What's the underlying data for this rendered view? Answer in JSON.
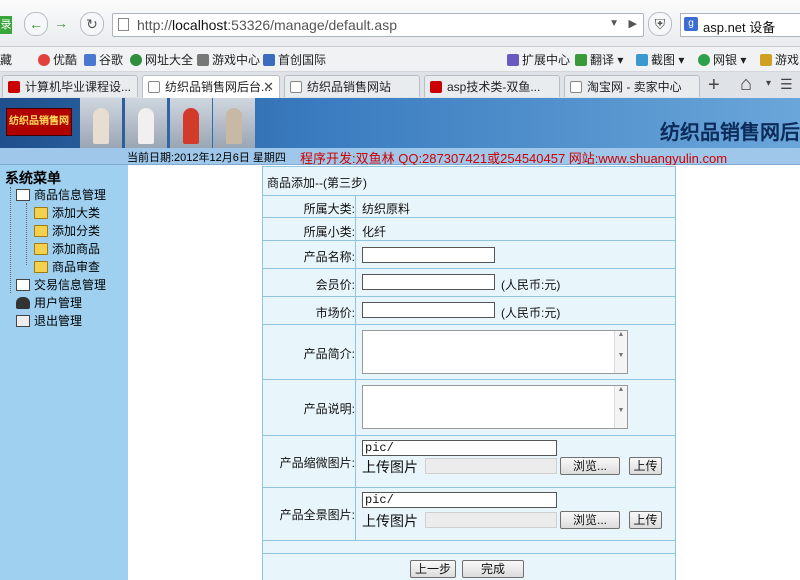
{
  "browser": {
    "url_prefix": "http://",
    "url_host": "localhost",
    "url_rest": ":53326/manage/default.asp",
    "search_text": "asp.net 设备",
    "left_stub": "录",
    "bookmarks": [
      "藏",
      "优酷",
      "谷歌",
      "网址大全",
      "游戏中心",
      "首创国际",
      "扩展中心",
      "翻译",
      "截图",
      "网银",
      "游戏"
    ],
    "tabs": [
      {
        "label": "计算机毕业课程设...",
        "active": false
      },
      {
        "label": "纺织品销售网后台...",
        "active": true
      },
      {
        "label": "纺织品销售网站",
        "active": false
      },
      {
        "label": "asp技术类-双鱼...",
        "active": false
      },
      {
        "label": "淘宝网 - 卖家中心",
        "active": false
      }
    ],
    "new_tab": "+",
    "home": "⌂"
  },
  "header": {
    "logo_text": "纺织品销售网",
    "site_title": "纺织品销售网后",
    "date_text": "当前日期:2012年12月6日 星期四",
    "dev_text": "程序开发:双鱼林 QQ:287307421或254540457 网站:www.shuangyulin.com"
  },
  "sidebar": {
    "title": "系统菜单",
    "items": [
      {
        "label": "商品信息管理"
      },
      {
        "label": "添加大类"
      },
      {
        "label": "添加分类"
      },
      {
        "label": "添加商品"
      },
      {
        "label": "商品审查"
      },
      {
        "label": "交易信息管理"
      },
      {
        "label": "用户管理"
      },
      {
        "label": "退出管理"
      }
    ]
  },
  "form": {
    "heading": "商品添加--(第三步)",
    "big_category_label": "所属大类:",
    "big_category_value": "纺织原料",
    "small_category_label": "所属小类:",
    "small_category_value": "化纤",
    "name_label": "产品名称:",
    "member_price_label": "会员价:",
    "market_price_label": "市场价:",
    "currency_note": "(人民币:元)",
    "intro_label": "产品简介:",
    "desc_label": "产品说明:",
    "thumb_label": "产品缩微图片:",
    "full_label": "产品全景图片:",
    "pic_value": "pic/",
    "upload_label": "上传图片",
    "browse_button": "浏览...",
    "upload_button": "上传",
    "prev_button": "上一步",
    "finish_button": "完成"
  }
}
